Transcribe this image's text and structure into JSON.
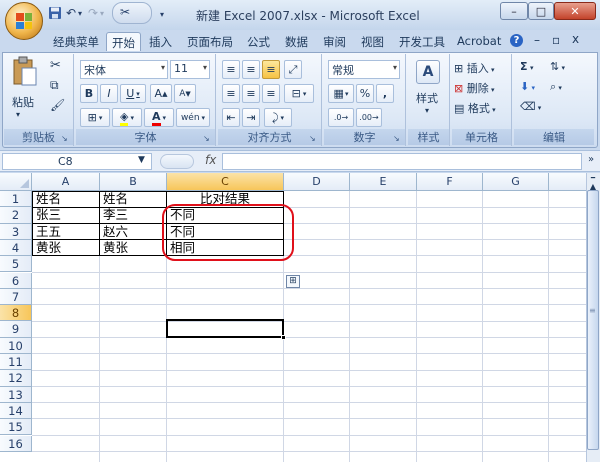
{
  "window": {
    "title": "新建 Excel 2007.xlsx - Microsoft Excel",
    "minimize": "–",
    "maximize": "□",
    "close": "✕"
  },
  "ribbon_tabs": [
    "经典菜单",
    "开始",
    "插入",
    "页面布局",
    "公式",
    "数据",
    "审阅",
    "视图",
    "开发工具",
    "Acrobat"
  ],
  "active_tab": "开始",
  "ribbon_right": {
    "help": "?",
    "min": "–",
    "restore": "▫",
    "close": "x"
  },
  "groups": {
    "clipboard": {
      "label": "剪贴板",
      "paste": "粘贴"
    },
    "font": {
      "label": "字体",
      "font_name": "宋体",
      "font_size": "11",
      "bold": "B",
      "italic": "I",
      "underline": "U",
      "grow": "A",
      "shrink": "A",
      "phonetic": "wén"
    },
    "alignment": {
      "label": "对齐方式"
    },
    "number": {
      "label": "数字",
      "format": "常规",
      "percent": "%",
      "comma": ","
    },
    "styles": {
      "label": "样式",
      "name": "样式"
    },
    "cells": {
      "label": "单元格",
      "insert": "插入",
      "delete": "删除",
      "format": "格式"
    },
    "editing": {
      "label": "编辑",
      "sum": "Σ"
    }
  },
  "formula_bar": {
    "cell_ref": "C8",
    "fx": "fx",
    "value": ""
  },
  "columns": [
    "A",
    "B",
    "C",
    "D",
    "E",
    "F",
    "G"
  ],
  "rows": [
    "1",
    "2",
    "3",
    "4",
    "5",
    "6",
    "7",
    "8",
    "9",
    "10",
    "11",
    "12",
    "13",
    "14",
    "15",
    "16"
  ],
  "cells": {
    "A1": "姓名",
    "B1": "姓名",
    "C1": "比对结果",
    "A2": "张三",
    "B2": "李三",
    "C2": "不同",
    "A3": "王五",
    "B3": "赵六",
    "C3": "不同",
    "A4": "黄张",
    "B4": "黄张",
    "C4": "相同"
  },
  "selected_cell": "C8",
  "annotation_color": "#e0101a"
}
